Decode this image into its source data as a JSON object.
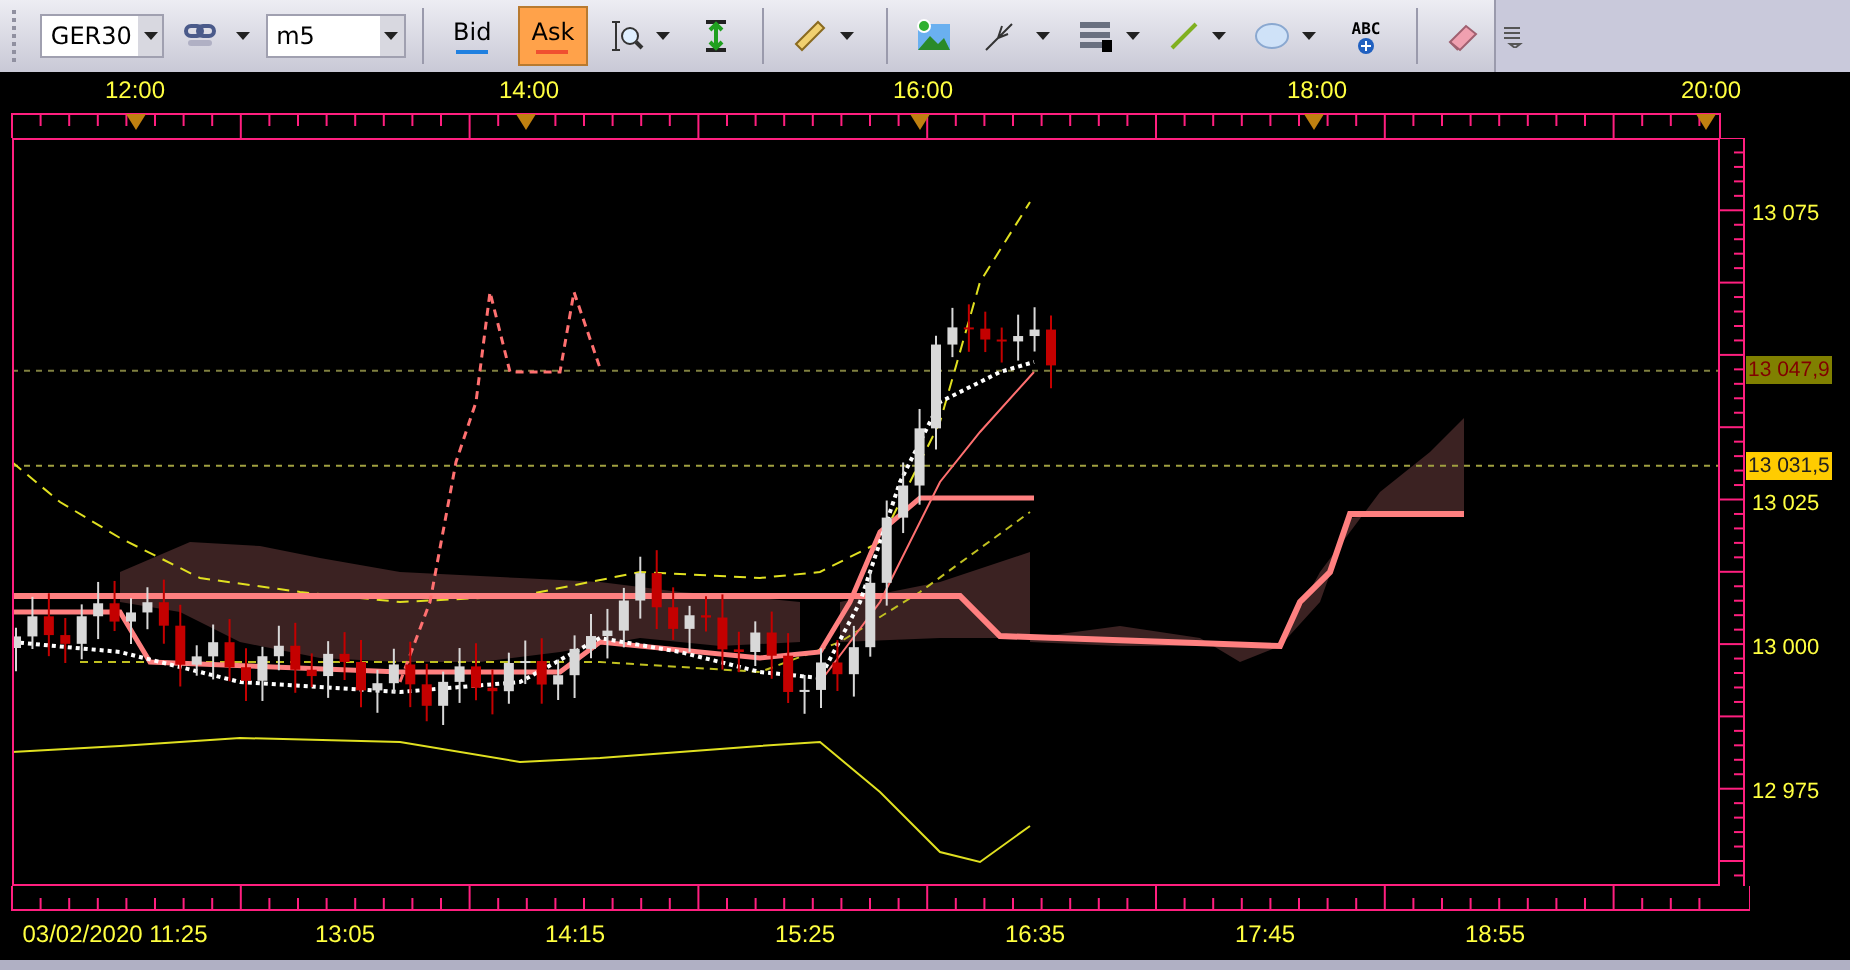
{
  "toolbar": {
    "symbol": "GER30",
    "timeframe": "m5",
    "quote_buttons": [
      {
        "label": "Bid",
        "selected": false
      },
      {
        "label": "Ask",
        "selected": true
      }
    ],
    "text_tool_label": "ABC"
  },
  "chart": {
    "top_time_labels": [
      "12:00",
      "14:00",
      "16:00",
      "18:00",
      "20:00"
    ],
    "price_labels": [
      {
        "kind": "tick",
        "text": "13 075"
      },
      {
        "kind": "bid",
        "text": "13 047,9"
      },
      {
        "kind": "ask",
        "text": "13 031,5"
      },
      {
        "kind": "tick",
        "text": "13 025"
      },
      {
        "kind": "tick",
        "text": "13 000"
      },
      {
        "kind": "tick",
        "text": "12 975"
      }
    ],
    "bottom_time_labels": [
      "03/02/2020 11:25",
      "13:05",
      "14:15",
      "15:25",
      "16:35",
      "17:45",
      "18:55"
    ]
  }
}
